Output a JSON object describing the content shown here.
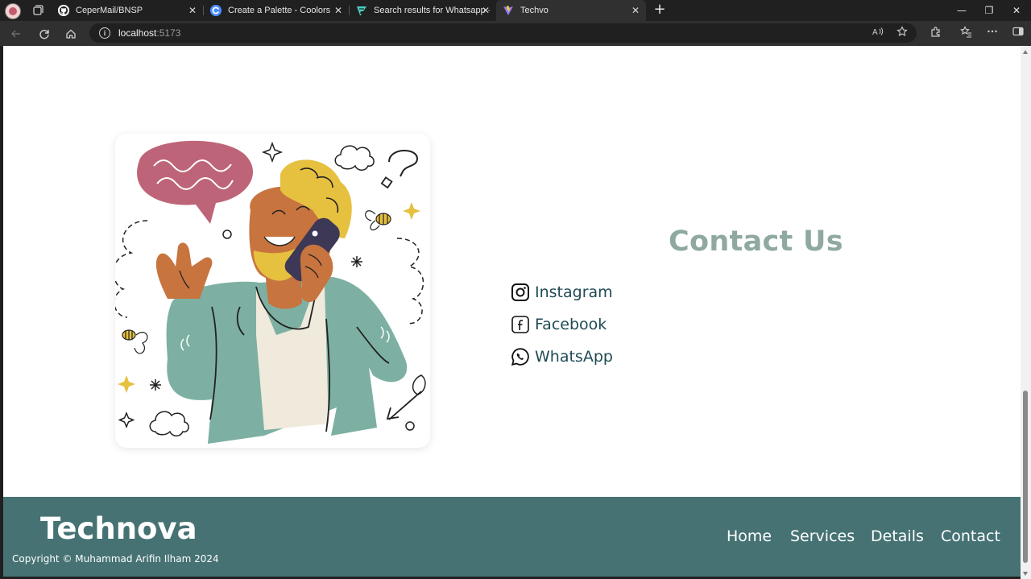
{
  "browser": {
    "tabs": [
      {
        "title": "CeperMail/BNSP",
        "favicon": "github-icon"
      },
      {
        "title": "Create a Palette - Coolors",
        "favicon": "coolors-icon"
      },
      {
        "title": "Search results for Whatsapp - Fla",
        "favicon": "flaticon-icon"
      },
      {
        "title": "Techvo",
        "favicon": "vite-icon",
        "active": true
      }
    ],
    "close_glyph": "✕",
    "new_tab_glyph": "+",
    "address": {
      "host": "localhost",
      "port": ":5173"
    },
    "window_controls": {
      "minimize": "—",
      "restore": "❐",
      "close": "✕"
    }
  },
  "page": {
    "contact_title": "Contact Us",
    "socials": [
      {
        "label": "Instagram",
        "icon": "instagram-icon"
      },
      {
        "label": "Facebook",
        "icon": "facebook-icon"
      },
      {
        "label": "WhatsApp",
        "icon": "whatsapp-icon"
      }
    ],
    "footer": {
      "brand": "Technova",
      "copyright": "Copyright © Muhammad Arifin Ilham 2024",
      "nav": [
        "Home",
        "Services",
        "Details",
        "Contact"
      ]
    }
  },
  "colors": {
    "tabbar_bg": "#202020",
    "toolbar_bg": "#303030",
    "contact_title": "#8fa9a1",
    "social_text": "#1f4a55",
    "footer_bg": "#467274",
    "illustration_jacket": "#7db0a2",
    "illustration_skin": "#c8743f",
    "illustration_hair": "#e6c03f",
    "illustration_bubble": "#be6478",
    "illustration_phone": "#3d3856"
  }
}
